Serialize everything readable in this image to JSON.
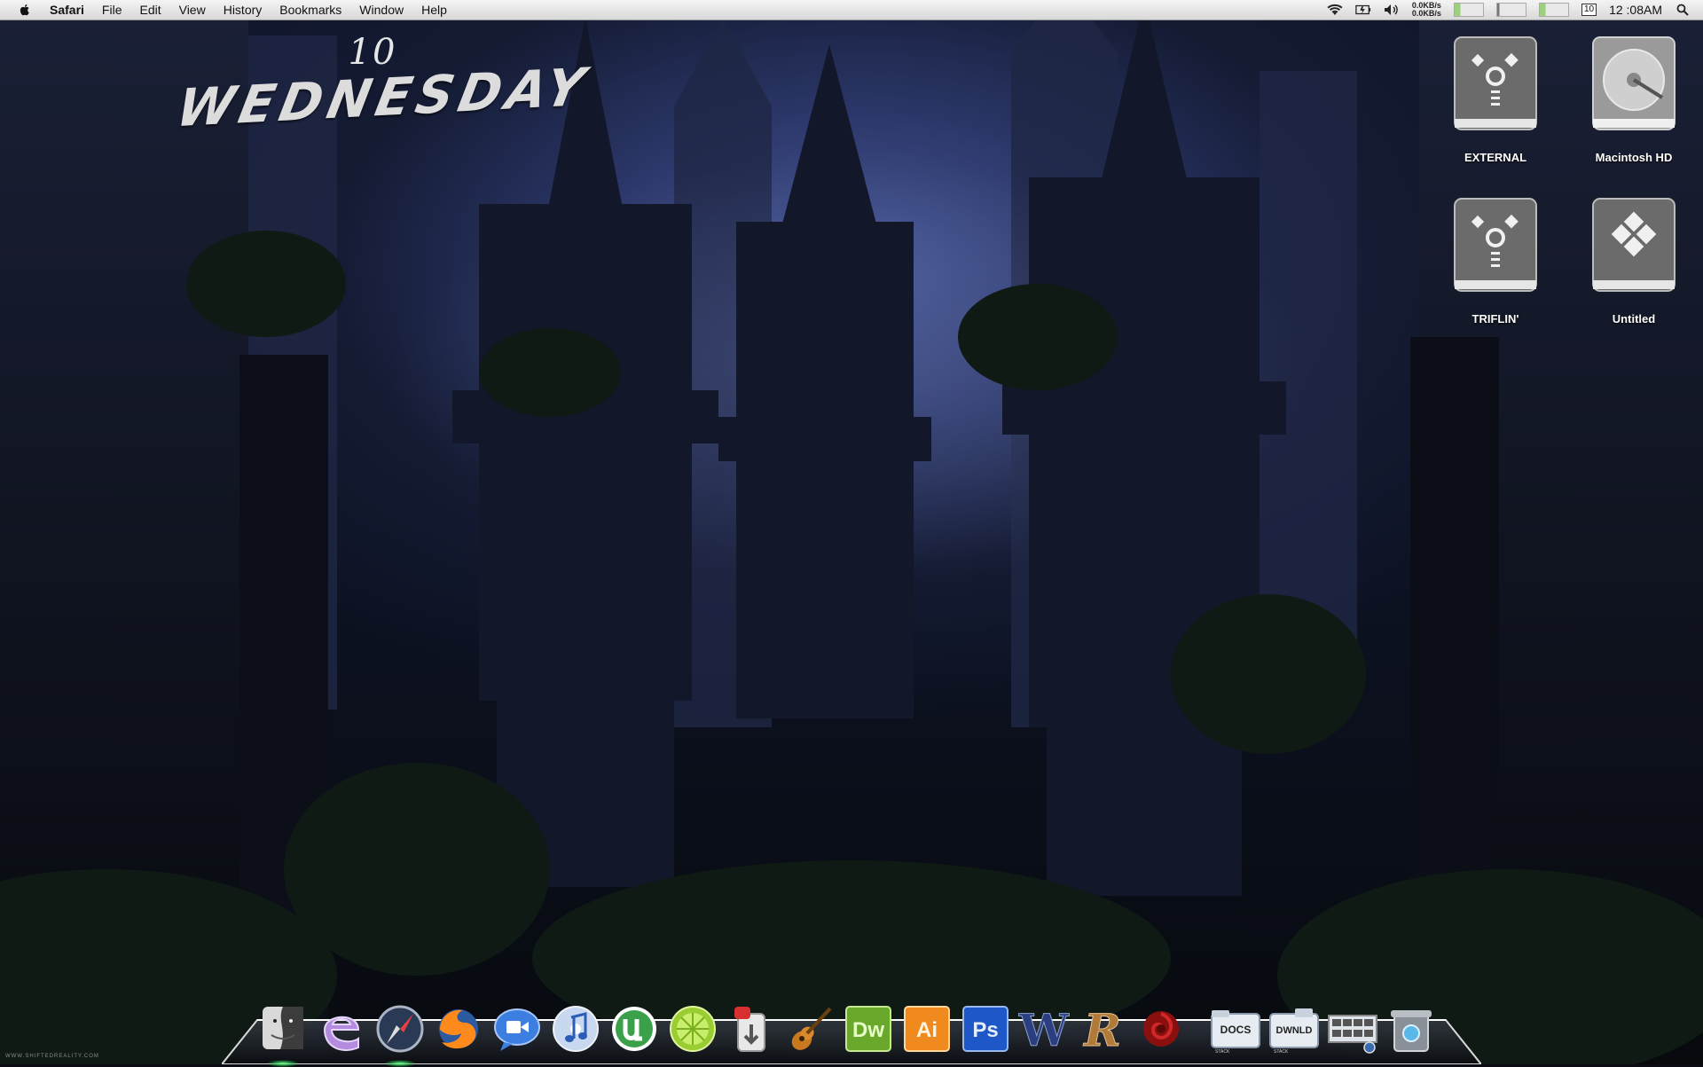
{
  "menubar": {
    "app_name": "Safari",
    "menus": [
      "File",
      "Edit",
      "View",
      "History",
      "Bookmarks",
      "Window",
      "Help"
    ],
    "net_up": "0.0KB/s",
    "net_down": "0.0KB/s",
    "date_badge": "10",
    "clock": "12 :08AM",
    "status_icons": [
      "wifi-icon",
      "battery-icon",
      "volume-icon",
      "search-icon"
    ]
  },
  "date_widget": {
    "day_number": "10",
    "weekday": "WEDNESDAY"
  },
  "desktop": {
    "drives": [
      {
        "label": "EXTERNAL",
        "icon": "firewire-drive-icon"
      },
      {
        "label": "Macintosh HD",
        "icon": "hard-disk-icon"
      },
      {
        "label": "TRIFLIN'",
        "icon": "firewire-drive-icon"
      },
      {
        "label": "Untitled",
        "icon": "bootcamp-drive-icon"
      }
    ]
  },
  "dock": {
    "apps": [
      {
        "name": "Finder",
        "icon": "finder-icon",
        "running": true
      },
      {
        "name": "Coda",
        "icon": "e-editor-icon",
        "running": false
      },
      {
        "name": "Safari",
        "icon": "safari-compass-icon",
        "running": true
      },
      {
        "name": "Firefox",
        "icon": "firefox-icon",
        "running": false
      },
      {
        "name": "iChat",
        "icon": "ichat-video-icon",
        "running": false
      },
      {
        "name": "iTunes",
        "icon": "itunes-icon",
        "running": false
      },
      {
        "name": "uTorrent",
        "icon": "utorrent-icon",
        "running": false
      },
      {
        "name": "LimeWire",
        "icon": "limewire-icon",
        "running": false
      },
      {
        "name": "Transmit",
        "icon": "transmit-icon",
        "running": false
      },
      {
        "name": "GarageBand",
        "icon": "guitar-icon",
        "running": false
      },
      {
        "name": "Dreamweaver",
        "icon": "dreamweaver-icon",
        "running": false,
        "text": "Dw"
      },
      {
        "name": "Illustrator",
        "icon": "illustrator-icon",
        "running": false,
        "text": "Ai"
      },
      {
        "name": "Photoshop",
        "icon": "photoshop-icon",
        "running": false,
        "text": "Ps"
      },
      {
        "name": "W",
        "icon": "w-logo-icon",
        "running": false,
        "text": "W"
      },
      {
        "name": "R",
        "icon": "r-logo-icon",
        "running": false,
        "text": "R"
      },
      {
        "name": "Rose",
        "icon": "red-rose-icon",
        "running": false
      }
    ],
    "stacks": [
      {
        "label": "DOCS",
        "sub": "STACK",
        "icon": "docs-stack-icon"
      },
      {
        "label": "DWNLD",
        "sub": "STACK",
        "icon": "downloads-stack-icon"
      },
      {
        "label": "",
        "icon": "applications-stack-icon"
      },
      {
        "label": "",
        "icon": "trash-icon"
      }
    ]
  },
  "watermark": "WWW.SHIFTEDREALITY.COM",
  "colors": {
    "sky": "#4a5a9a",
    "running_indicator": "#6eff8c",
    "menubar": "#e6e6e6"
  }
}
